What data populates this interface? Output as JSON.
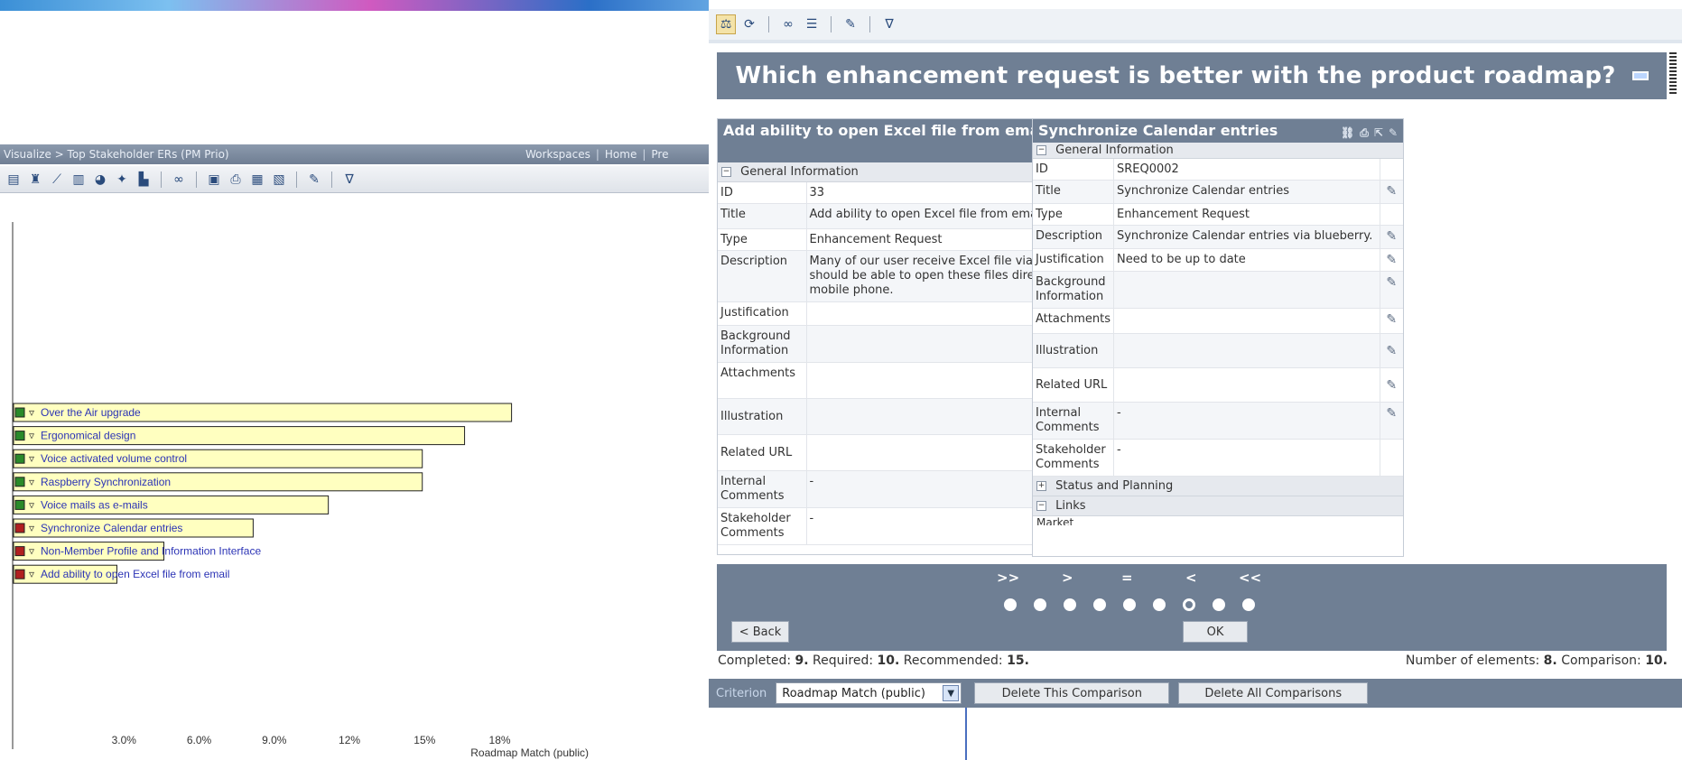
{
  "colors": {
    "header": "#6f7f94",
    "bar_fill": "#ffffc0",
    "bar_stroke": "#222222",
    "accent_blue": "#2b33b5"
  },
  "left": {
    "breadcrumb": "Visualize > Top Stakeholder ERs (PM Prio)",
    "nav": {
      "workspaces": "Workspaces",
      "sep": "|",
      "home": "Home",
      "pre": "Pre"
    },
    "toolbar_icons": [
      "tree-icon",
      "org-icon",
      "line-chart-icon",
      "bar-chart-icon",
      "pie-chart-icon",
      "radar-icon",
      "stacked-icon",
      "binoculars-icon",
      "save-icon",
      "print-icon",
      "export-icon",
      "image-icon",
      "edit-icon",
      "filter-icon"
    ]
  },
  "chart_data": {
    "type": "bar",
    "orientation": "horizontal",
    "categories": [
      "Over the Air upgrade",
      "Ergonomical design",
      "Voice activated volume control",
      "Raspberry Synchronization",
      "Voice mails as e-mails",
      "Synchronize Calendar entries",
      "Non-Member Profile and Information Interface",
      "Add ability to open Excel file from email"
    ],
    "values": [
      10.6,
      9.6,
      8.7,
      8.7,
      6.7,
      5.1,
      3.2,
      2.2
    ],
    "flag_colors": [
      "green",
      "green",
      "green",
      "green",
      "green",
      "red",
      "red",
      "red"
    ],
    "xlim": [
      0,
      10.5
    ],
    "xticks": [
      "3.0%",
      "6.0%",
      "9.0%",
      "12%",
      "15%",
      "18%"
    ],
    "xtick_values": [
      1.6,
      3.2,
      4.8,
      6.4,
      8.0,
      9.6
    ],
    "xlabel": "Roadmap Match (public)",
    "grid": false
  },
  "right": {
    "toolbar_icons": [
      "balance-icon",
      "refresh-icon",
      "binoculars-icon",
      "list-icon",
      "edit-icon",
      "filter-icon"
    ],
    "question": "Which enhancement request is better with the product roadmap?",
    "left_card": {
      "title": "Add ability to open Excel file from email",
      "section": "General Information",
      "rows": [
        {
          "k": "ID",
          "v": "33"
        },
        {
          "k": "Title",
          "v": "Add ability to open Excel file from email"
        },
        {
          "k": "Type",
          "v": "Enhancement Request"
        },
        {
          "k": "Description",
          "v": "Many of our user receive Excel file via email. They should be able to open these files directly from their mobile phone."
        },
        {
          "k": "Justification",
          "v": ""
        },
        {
          "k": "Background Information",
          "v": ""
        },
        {
          "k": "Attachments",
          "v": ""
        },
        {
          "k": "Illustration",
          "v": ""
        },
        {
          "k": "Related URL",
          "v": ""
        },
        {
          "k": "Internal Comments",
          "v": "-"
        },
        {
          "k": "Stakeholder Comments",
          "v": "-"
        }
      ]
    },
    "right_card": {
      "title": "Synchronize Calendar entries",
      "section": "General Information",
      "rows": [
        {
          "k": "ID",
          "v": "SREQ0002"
        },
        {
          "k": "Title",
          "v": "Synchronize Calendar entries"
        },
        {
          "k": "Type",
          "v": "Enhancement Request"
        },
        {
          "k": "Description",
          "v": "Synchronize Calendar entries via blueberry."
        },
        {
          "k": "Justification",
          "v": "Need to be up to date"
        },
        {
          "k": "Background Information",
          "v": ""
        },
        {
          "k": "Attachments",
          "v": ""
        },
        {
          "k": "Illustration",
          "v": ""
        },
        {
          "k": "Related URL",
          "v": ""
        },
        {
          "k": "Internal Comments",
          "v": "-"
        },
        {
          "k": "Stakeholder Comments",
          "v": "-"
        }
      ],
      "section2": "Status and Planning",
      "section3": "Links",
      "cut_row": "Market"
    },
    "vote": {
      "labels": [
        ">>",
        ">",
        "=",
        "<",
        "<<"
      ],
      "dots": 9,
      "selected_index": 6,
      "back_label": "< Back",
      "ok_label": "OK"
    },
    "status": {
      "completed_label": "Completed:",
      "completed": "9.",
      "required_label": "Required:",
      "required": "10.",
      "recommended_label": "Recommended:",
      "recommended": "15.",
      "elements_label": "Number of elements:",
      "elements": "8.",
      "comparison_label": "Comparison:",
      "comparison": "10."
    },
    "criterion": {
      "label": "Criterion",
      "selected": "Roadmap Match (public)",
      "delete_one": "Delete This Comparison",
      "delete_all": "Delete All Comparisons"
    }
  }
}
